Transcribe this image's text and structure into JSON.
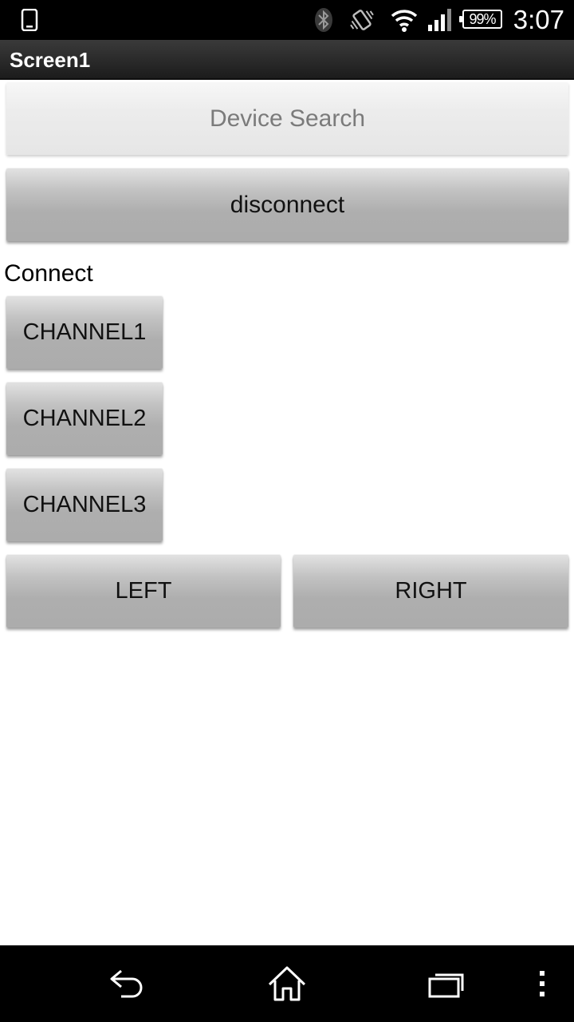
{
  "status_bar": {
    "battery": "99%",
    "time": "3:07",
    "icons": [
      "phone-icon",
      "bluetooth-icon",
      "vibrate-icon",
      "wifi-icon",
      "signal-icon",
      "battery-icon"
    ]
  },
  "title_bar": {
    "title": "Screen1"
  },
  "main": {
    "device_search": "Device Search",
    "disconnect": "disconnect",
    "connect_label": "Connect",
    "channel1": "CHANNEL1",
    "channel2": "CHANNEL2",
    "channel3": "CHANNEL3",
    "left": "LEFT",
    "right": "RIGHT"
  },
  "nav_bar": {
    "icons": [
      "back-icon",
      "home-icon",
      "recent-apps-icon",
      "menu-icon"
    ]
  },
  "colors": {
    "status_bar": "#000000",
    "title_bar": "#1c1c1c",
    "background": "#ffffff",
    "button_text": "#111111",
    "disabled_text": "#7b7b7b"
  }
}
